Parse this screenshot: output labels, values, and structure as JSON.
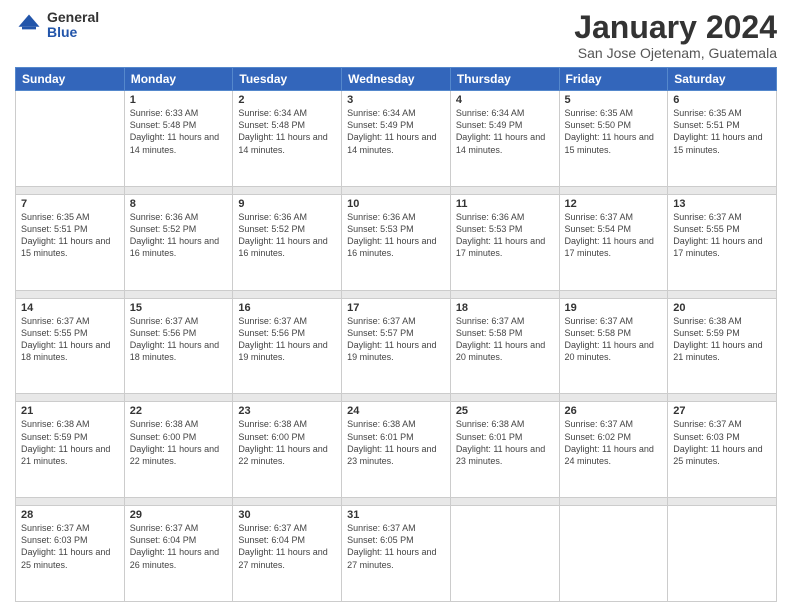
{
  "logo": {
    "general": "General",
    "blue": "Blue"
  },
  "header": {
    "title": "January 2024",
    "subtitle": "San Jose Ojetenam, Guatemala"
  },
  "weekdays": [
    "Sunday",
    "Monday",
    "Tuesday",
    "Wednesday",
    "Thursday",
    "Friday",
    "Saturday"
  ],
  "weeks": [
    [
      {
        "day": "",
        "sunrise": "",
        "sunset": "",
        "daylight": ""
      },
      {
        "day": "1",
        "sunrise": "Sunrise: 6:33 AM",
        "sunset": "Sunset: 5:48 PM",
        "daylight": "Daylight: 11 hours and 14 minutes."
      },
      {
        "day": "2",
        "sunrise": "Sunrise: 6:34 AM",
        "sunset": "Sunset: 5:48 PM",
        "daylight": "Daylight: 11 hours and 14 minutes."
      },
      {
        "day": "3",
        "sunrise": "Sunrise: 6:34 AM",
        "sunset": "Sunset: 5:49 PM",
        "daylight": "Daylight: 11 hours and 14 minutes."
      },
      {
        "day": "4",
        "sunrise": "Sunrise: 6:34 AM",
        "sunset": "Sunset: 5:49 PM",
        "daylight": "Daylight: 11 hours and 14 minutes."
      },
      {
        "day": "5",
        "sunrise": "Sunrise: 6:35 AM",
        "sunset": "Sunset: 5:50 PM",
        "daylight": "Daylight: 11 hours and 15 minutes."
      },
      {
        "day": "6",
        "sunrise": "Sunrise: 6:35 AM",
        "sunset": "Sunset: 5:51 PM",
        "daylight": "Daylight: 11 hours and 15 minutes."
      }
    ],
    [
      {
        "day": "7",
        "sunrise": "Sunrise: 6:35 AM",
        "sunset": "Sunset: 5:51 PM",
        "daylight": "Daylight: 11 hours and 15 minutes."
      },
      {
        "day": "8",
        "sunrise": "Sunrise: 6:36 AM",
        "sunset": "Sunset: 5:52 PM",
        "daylight": "Daylight: 11 hours and 16 minutes."
      },
      {
        "day": "9",
        "sunrise": "Sunrise: 6:36 AM",
        "sunset": "Sunset: 5:52 PM",
        "daylight": "Daylight: 11 hours and 16 minutes."
      },
      {
        "day": "10",
        "sunrise": "Sunrise: 6:36 AM",
        "sunset": "Sunset: 5:53 PM",
        "daylight": "Daylight: 11 hours and 16 minutes."
      },
      {
        "day": "11",
        "sunrise": "Sunrise: 6:36 AM",
        "sunset": "Sunset: 5:53 PM",
        "daylight": "Daylight: 11 hours and 17 minutes."
      },
      {
        "day": "12",
        "sunrise": "Sunrise: 6:37 AM",
        "sunset": "Sunset: 5:54 PM",
        "daylight": "Daylight: 11 hours and 17 minutes."
      },
      {
        "day": "13",
        "sunrise": "Sunrise: 6:37 AM",
        "sunset": "Sunset: 5:55 PM",
        "daylight": "Daylight: 11 hours and 17 minutes."
      }
    ],
    [
      {
        "day": "14",
        "sunrise": "Sunrise: 6:37 AM",
        "sunset": "Sunset: 5:55 PM",
        "daylight": "Daylight: 11 hours and 18 minutes."
      },
      {
        "day": "15",
        "sunrise": "Sunrise: 6:37 AM",
        "sunset": "Sunset: 5:56 PM",
        "daylight": "Daylight: 11 hours and 18 minutes."
      },
      {
        "day": "16",
        "sunrise": "Sunrise: 6:37 AM",
        "sunset": "Sunset: 5:56 PM",
        "daylight": "Daylight: 11 hours and 19 minutes."
      },
      {
        "day": "17",
        "sunrise": "Sunrise: 6:37 AM",
        "sunset": "Sunset: 5:57 PM",
        "daylight": "Daylight: 11 hours and 19 minutes."
      },
      {
        "day": "18",
        "sunrise": "Sunrise: 6:37 AM",
        "sunset": "Sunset: 5:58 PM",
        "daylight": "Daylight: 11 hours and 20 minutes."
      },
      {
        "day": "19",
        "sunrise": "Sunrise: 6:37 AM",
        "sunset": "Sunset: 5:58 PM",
        "daylight": "Daylight: 11 hours and 20 minutes."
      },
      {
        "day": "20",
        "sunrise": "Sunrise: 6:38 AM",
        "sunset": "Sunset: 5:59 PM",
        "daylight": "Daylight: 11 hours and 21 minutes."
      }
    ],
    [
      {
        "day": "21",
        "sunrise": "Sunrise: 6:38 AM",
        "sunset": "Sunset: 5:59 PM",
        "daylight": "Daylight: 11 hours and 21 minutes."
      },
      {
        "day": "22",
        "sunrise": "Sunrise: 6:38 AM",
        "sunset": "Sunset: 6:00 PM",
        "daylight": "Daylight: 11 hours and 22 minutes."
      },
      {
        "day": "23",
        "sunrise": "Sunrise: 6:38 AM",
        "sunset": "Sunset: 6:00 PM",
        "daylight": "Daylight: 11 hours and 22 minutes."
      },
      {
        "day": "24",
        "sunrise": "Sunrise: 6:38 AM",
        "sunset": "Sunset: 6:01 PM",
        "daylight": "Daylight: 11 hours and 23 minutes."
      },
      {
        "day": "25",
        "sunrise": "Sunrise: 6:38 AM",
        "sunset": "Sunset: 6:01 PM",
        "daylight": "Daylight: 11 hours and 23 minutes."
      },
      {
        "day": "26",
        "sunrise": "Sunrise: 6:37 AM",
        "sunset": "Sunset: 6:02 PM",
        "daylight": "Daylight: 11 hours and 24 minutes."
      },
      {
        "day": "27",
        "sunrise": "Sunrise: 6:37 AM",
        "sunset": "Sunset: 6:03 PM",
        "daylight": "Daylight: 11 hours and 25 minutes."
      }
    ],
    [
      {
        "day": "28",
        "sunrise": "Sunrise: 6:37 AM",
        "sunset": "Sunset: 6:03 PM",
        "daylight": "Daylight: 11 hours and 25 minutes."
      },
      {
        "day": "29",
        "sunrise": "Sunrise: 6:37 AM",
        "sunset": "Sunset: 6:04 PM",
        "daylight": "Daylight: 11 hours and 26 minutes."
      },
      {
        "day": "30",
        "sunrise": "Sunrise: 6:37 AM",
        "sunset": "Sunset: 6:04 PM",
        "daylight": "Daylight: 11 hours and 27 minutes."
      },
      {
        "day": "31",
        "sunrise": "Sunrise: 6:37 AM",
        "sunset": "Sunset: 6:05 PM",
        "daylight": "Daylight: 11 hours and 27 minutes."
      },
      {
        "day": "",
        "sunrise": "",
        "sunset": "",
        "daylight": ""
      },
      {
        "day": "",
        "sunrise": "",
        "sunset": "",
        "daylight": ""
      },
      {
        "day": "",
        "sunrise": "",
        "sunset": "",
        "daylight": ""
      }
    ]
  ]
}
